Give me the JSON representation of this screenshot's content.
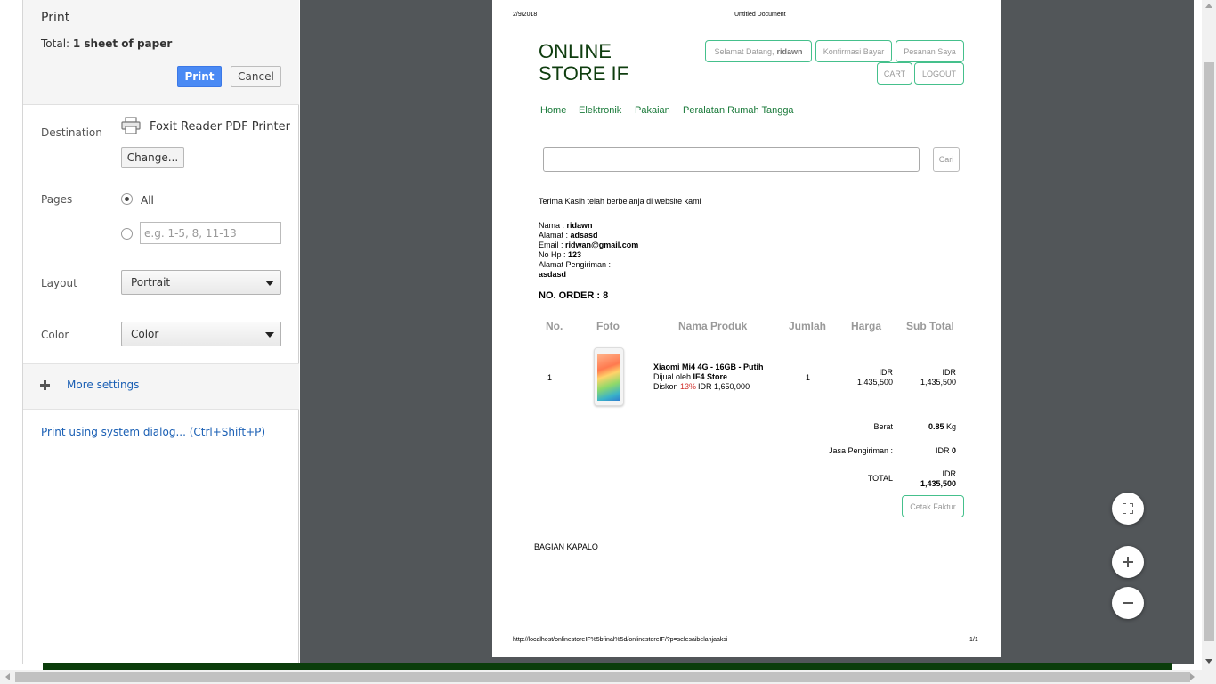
{
  "print_panel": {
    "title": "Print",
    "total_prefix": "Total: ",
    "total_value": "1 sheet of paper",
    "print_button": "Print",
    "cancel_button": "Cancel",
    "destination_label": "Destination",
    "printer_name": "Foxit Reader PDF Printer",
    "change_button": "Change...",
    "pages_label": "Pages",
    "pages_all_label": "All",
    "pages_placeholder": "e.g. 1-5, 8, 11-13",
    "layout_label": "Layout",
    "layout_value": "Portrait",
    "color_label": "Color",
    "color_value": "Color",
    "more_settings": "More settings",
    "system_dialog": "Print using system dialog... (Ctrl+Shift+P)"
  },
  "preview": {
    "header_date": "2/9/2018",
    "header_title": "Untitled Document",
    "footer_url": "http://localhost/onlinestoreIF%5bfinal%5d/onlinestoreIF/?p=selesaibelanjaaksi",
    "footer_page": "1/1"
  },
  "store": {
    "logo": "ONLINE STORE IF",
    "welcome_prefix": "Selamat Datang,",
    "welcome_user": "ridawn",
    "konfirmasi": "Konfirmasi Bayar",
    "pesanan": "Pesanan Saya",
    "cart": "CART",
    "logout": "LOGOUT",
    "nav": [
      "Home",
      "Elektronik",
      "Pakaian",
      "Peralatan Rumah Tangga"
    ],
    "search_button": "Cari",
    "thanks": "Terima Kasih telah berbelanja di website kami",
    "customer": {
      "nama_label": "Nama   : ",
      "nama": "ridawn",
      "alamat_label": "Alamat : ",
      "alamat": "adsasd",
      "email_label": "Email  : ",
      "email": "ridwan@gmail.com",
      "hp_label": "No Hp  : ",
      "hp": "123",
      "pengiriman_label": "Alamat Pengiriman :",
      "pengiriman": "asdasd"
    },
    "order_no": "NO. ORDER : 8",
    "table_headers": [
      "No.",
      "Foto",
      "Nama Produk",
      "Jumlah",
      "Harga",
      "Sub Total"
    ],
    "item": {
      "no": "1",
      "name": "Xiaomi Mi4 4G - 16GB - Putih",
      "seller_prefix": "Dijual oleh ",
      "seller": "IF4 Store",
      "discount_prefix": "Diskon ",
      "discount_pct": "13%",
      "original_price": "IDR 1,650,000",
      "qty": "1",
      "price_currency": "IDR",
      "price": "1,435,500",
      "subtotal_currency": "IDR",
      "subtotal": "1,435,500"
    },
    "berat_label": "Berat",
    "berat_value": "0.85",
    "berat_unit": " Kg",
    "jasa_label": "Jasa Pengiriman :",
    "jasa_currency": "IDR ",
    "jasa_value": "0",
    "total_label": "TOTAL",
    "total_currency": "IDR",
    "total_value": "1,435,500",
    "cetak_button": "Cetak Faktur",
    "footer": "BAGIAN KAPALO"
  },
  "colors": {
    "accent_blue": "#4a8af4",
    "store_green": "#45c08c",
    "preview_bg": "#525659"
  }
}
